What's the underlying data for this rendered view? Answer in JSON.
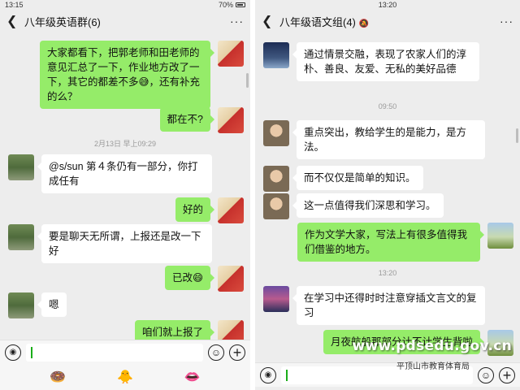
{
  "left": {
    "status": {
      "time": "13:15",
      "battery": "70%"
    },
    "title": "八年级英语群(6)",
    "messages": [
      {
        "from": "me",
        "text": "大家都看下，把郭老师和田老师的意见汇总了一下，作业地方改了一下，其它的都差不多😅，还有补充的么？"
      },
      {
        "from": "me",
        "text": "都在不?"
      },
      {
        "type": "time",
        "text": "2月13日 早上09:29"
      },
      {
        "from": "other",
        "text": "@s/sun 第４条仍有一部分，你打成任有"
      },
      {
        "from": "me",
        "text": "好的"
      },
      {
        "from": "other",
        "text": "要是聊天无所谓，上报还是改一下好"
      },
      {
        "from": "me",
        "text": "已改😄"
      },
      {
        "from": "other",
        "text": "嗯"
      },
      {
        "from": "me",
        "text": "咱们就上报了"
      }
    ],
    "tray_icons": [
      "🍩",
      "🐥",
      "👄"
    ]
  },
  "right": {
    "status": {
      "time": "13:20"
    },
    "title": "八年级语文组(4)",
    "messages": [
      {
        "from": "other",
        "text": "通过情景交融，表现了农家人们的淳朴、善良、友爱、无私的美好品德"
      },
      {
        "type": "time",
        "text": "09:50"
      },
      {
        "from": "other",
        "text": "重点突出，教给学生的是能力，是方法。"
      },
      {
        "from": "other",
        "text": "而不仅仅是简单的知识。"
      },
      {
        "from": "other",
        "text": "这一点值得我们深思和学习。"
      },
      {
        "from": "me",
        "text": "作为文学大家，写法上有很多值得我们借鉴的地方。"
      },
      {
        "type": "time",
        "text": "13:20"
      },
      {
        "from": "other",
        "text": "在学习中还得时时注意穿插文言文的复习"
      },
      {
        "from": "me",
        "text": "月夜航船那部分计不计学生背啦"
      }
    ]
  },
  "watermark": {
    "url": "www.pdsedu.gov.cn",
    "org": "平顶山市教育体育局"
  },
  "colors": {
    "out_bubble": "#95ec69",
    "in_bubble": "#ffffff",
    "chat_bg": "#ededed"
  },
  "icons": [
    "back-arrow-icon",
    "more-icon",
    "voice-icon",
    "emoji-icon",
    "plus-icon",
    "mute-icon"
  ]
}
